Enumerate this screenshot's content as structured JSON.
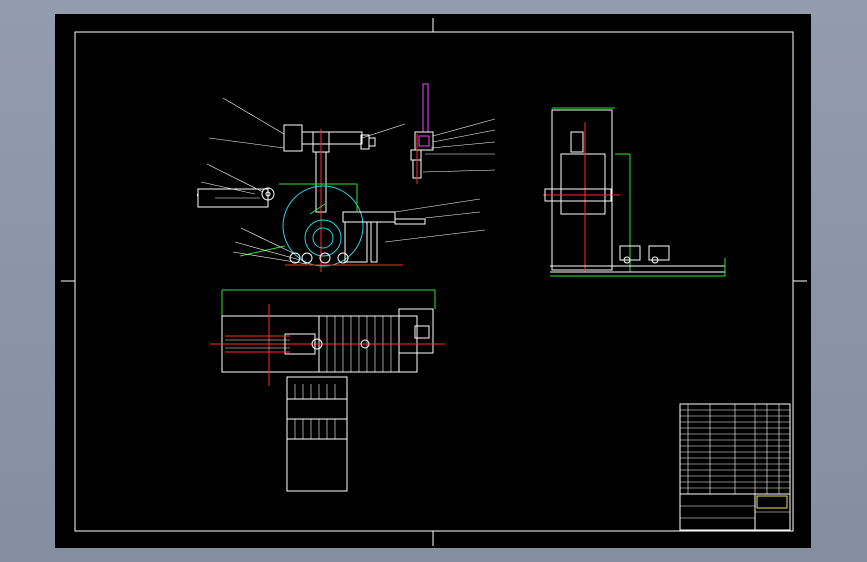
{
  "colors": {
    "background": "#000000",
    "viewport": "#8c95a8",
    "outline": "#ffffff",
    "centerline": "#ff2a2a",
    "dimension": "#2ee62e",
    "circle": "#27d3e6",
    "actuator": "#ff40ff",
    "highlight": "#f2e34a"
  },
  "title_block": {
    "drawing_title": "",
    "scale": ""
  }
}
